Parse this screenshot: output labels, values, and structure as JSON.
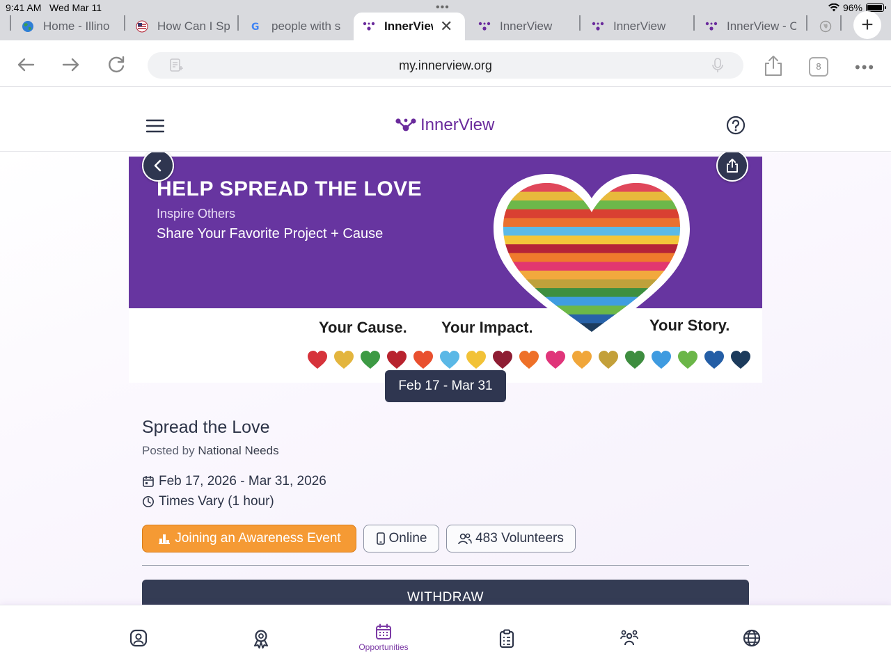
{
  "status": {
    "time": "9:41 AM",
    "date": "Wed Mar 11",
    "battery": "96%",
    "battery_level": 0.96
  },
  "tabs": [
    {
      "title": "Home - Illino",
      "icon": "globe-icon"
    },
    {
      "title": "How Can I Sp",
      "icon": "flag-icon"
    },
    {
      "title": "people with s",
      "icon": "google-icon"
    },
    {
      "title": "InnerView",
      "icon": "innerview-icon",
      "active": true
    },
    {
      "title": "InnerView",
      "icon": "innerview-icon"
    },
    {
      "title": "InnerView",
      "icon": "innerview-icon"
    },
    {
      "title": "InnerView - C",
      "icon": "innerview-icon"
    }
  ],
  "toolbar": {
    "url": "my.innerview.org",
    "tab_count": "8"
  },
  "header": {
    "brand": "InnerView"
  },
  "banner": {
    "title": "HELP SPREAD THE LOVE",
    "subtitle1": "Inspire Others",
    "subtitle2": "Share Your Favorite Project + Cause",
    "tag1": "Your Cause.",
    "tag2": "Your Impact.",
    "tag3": "Your Story.",
    "heart_colors": [
      "#d6333b",
      "#e3b53e",
      "#3d9a44",
      "#b8232e",
      "#e9502f",
      "#5bb8e6",
      "#f2c237",
      "#8e1d33",
      "#ee7028",
      "#e0357a",
      "#f0a63a",
      "#c3a03a",
      "#3e8d3f",
      "#3f9be0",
      "#6bb648",
      "#245ea6",
      "#1c3b5c"
    ],
    "stripe_colors": [
      "#e0475a",
      "#e8b93c",
      "#6db84a",
      "#d94032",
      "#ea7130",
      "#5cbae6",
      "#f3c63a",
      "#b52438",
      "#ef7a2c",
      "#e2376f",
      "#f2a93d",
      "#bfa13b",
      "#3d8f40",
      "#3f9de0",
      "#6cb848",
      "#2762a9",
      "#1d3c5e"
    ]
  },
  "event": {
    "date_pill": "Feb 17 - Mar 31",
    "title": "Spread the Love",
    "posted_prefix": "Posted by",
    "posted_by": "National Needs",
    "date_range": "Feb 17, 2026 - Mar 31, 2026",
    "time": "Times Vary (1 hour)",
    "chips": {
      "category": "Joining an Awareness Event",
      "location": "Online",
      "volunteers": "483 Volunteers"
    },
    "withdraw_label": "WITHDRAW"
  },
  "bottom_nav": {
    "items": [
      {
        "name": "profile",
        "icon": "profile-icon"
      },
      {
        "name": "awards",
        "icon": "award-icon"
      },
      {
        "name": "opportunities",
        "icon": "calendar-icon",
        "label": "Opportunities",
        "active": true
      },
      {
        "name": "tasks",
        "icon": "clipboard-icon"
      },
      {
        "name": "community",
        "icon": "people-icon"
      },
      {
        "name": "language",
        "icon": "globe-icon"
      }
    ]
  },
  "colors": {
    "brand_purple": "#6a2b9c",
    "banner_purple": "#6735a0",
    "dark_navy": "#2f3650",
    "orange": "#f59a34"
  }
}
